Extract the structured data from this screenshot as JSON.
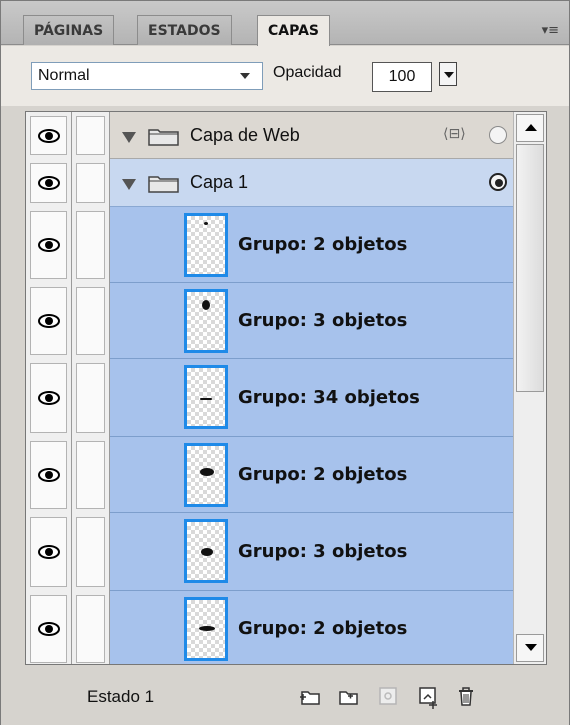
{
  "tabs": [
    {
      "label": "PÁGINAS",
      "active": false
    },
    {
      "label": "ESTADOS",
      "active": false
    },
    {
      "label": "CAPAS",
      "active": true
    }
  ],
  "panel_menu_icon": "panel-menu-icon",
  "blend_mode": {
    "value": "Normal"
  },
  "opacity": {
    "label": "Opacidad",
    "value": "100"
  },
  "layers": {
    "web_layer": {
      "name": "Capa de Web",
      "expanded": true
    },
    "layer1": {
      "name": "Capa 1",
      "expanded": true,
      "selected": true
    },
    "objects": [
      {
        "name": "Grupo: 2 objetos"
      },
      {
        "name": "Grupo: 3 objetos"
      },
      {
        "name": "Grupo: 34 objetos"
      },
      {
        "name": "Grupo: 2 objetos"
      },
      {
        "name": "Grupo: 3 objetos"
      },
      {
        "name": "Grupo: 2 objetos"
      }
    ]
  },
  "status": {
    "state_label": "Estado 1"
  },
  "bottom_icons": [
    "new-sublayer-icon",
    "new-layer-icon",
    "share-layer-icon",
    "add-state-icon",
    "trash-icon"
  ],
  "colors": {
    "selection": "#a7c2ec",
    "thumb_border": "#1f8ae8",
    "layer1_bg": "#c8d8f0"
  }
}
